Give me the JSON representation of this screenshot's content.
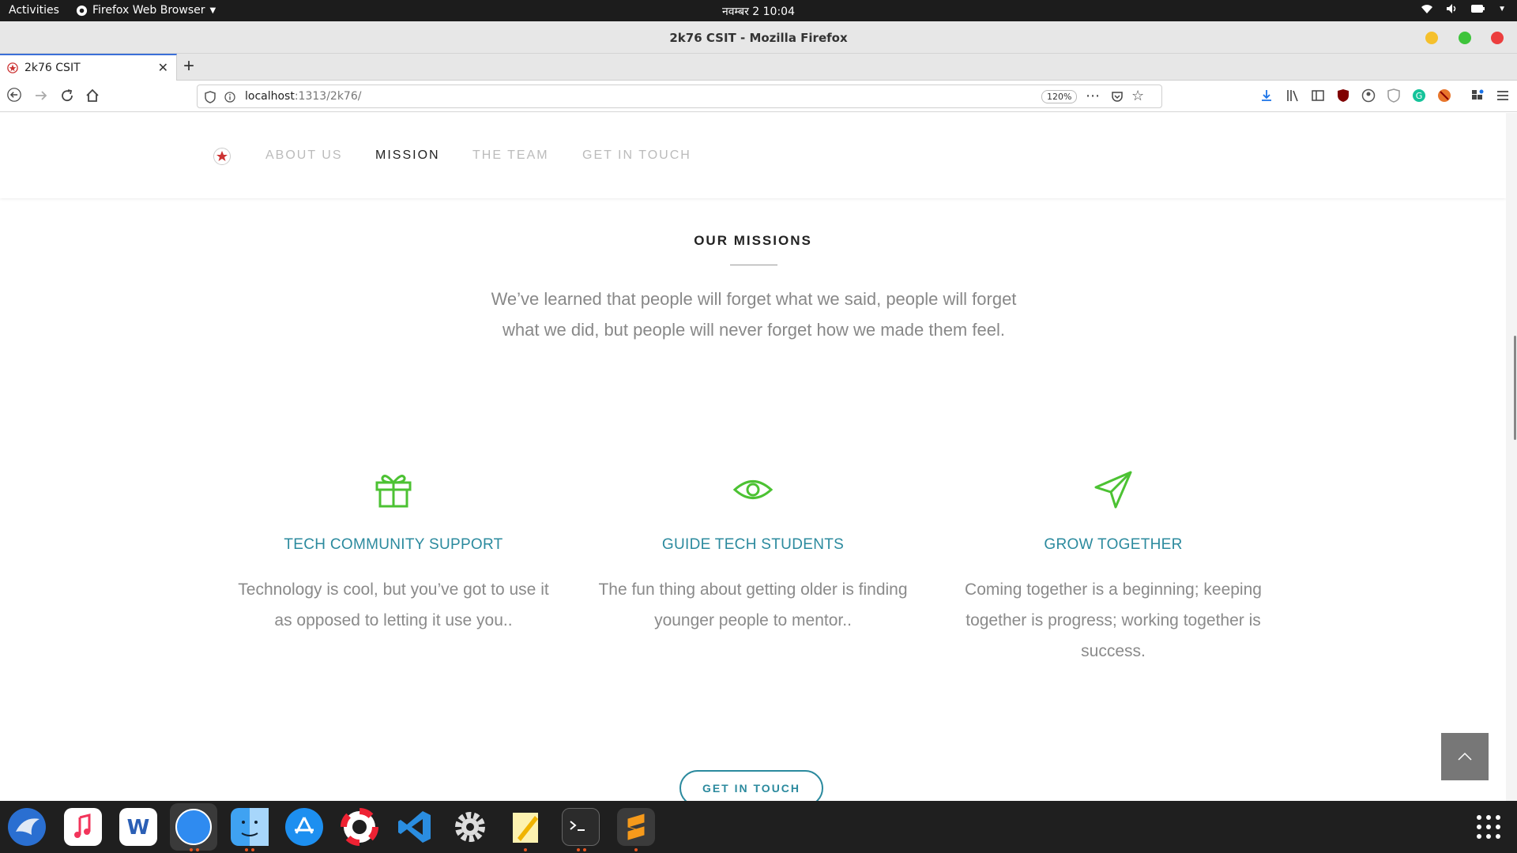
{
  "system": {
    "activities": "Activities",
    "app_menu": "Firefox Web Browser",
    "clock": "नवम्बर 2  10:04"
  },
  "window": {
    "title": "2k76 CSIT - Mozilla Firefox"
  },
  "tab": {
    "title": "2k76 CSIT"
  },
  "url": {
    "host": "localhost",
    "path": ":1313/2k76/",
    "zoom": "120%"
  },
  "site_nav": {
    "items": [
      "ABOUT US",
      "MISSION",
      "THE TEAM",
      "GET IN TOUCH"
    ],
    "active": "MISSION"
  },
  "missions": {
    "title": "OUR MISSIONS",
    "quote": "We’ve learned that people will forget what we said, people will forget what we did, but people will never forget how we made them feel.",
    "features": [
      {
        "icon": "gift-icon",
        "title": "TECH COMMUNITY SUPPORT",
        "text": "Technology is cool, but you’ve got to use it as opposed to letting it use you.."
      },
      {
        "icon": "eye-icon",
        "title": "GUIDE TECH STUDENTS",
        "text": "The fun thing about getting older is finding younger people to mentor.."
      },
      {
        "icon": "send-icon",
        "title": "GROW TOGETHER",
        "text": "Coming together is a beginning; keeping together is progress; working together is success."
      }
    ],
    "cta": "GET IN TOUCH"
  },
  "colors": {
    "accent": "#2b8a9e",
    "icon_green": "#4cc233",
    "muted_text": "#888888"
  }
}
